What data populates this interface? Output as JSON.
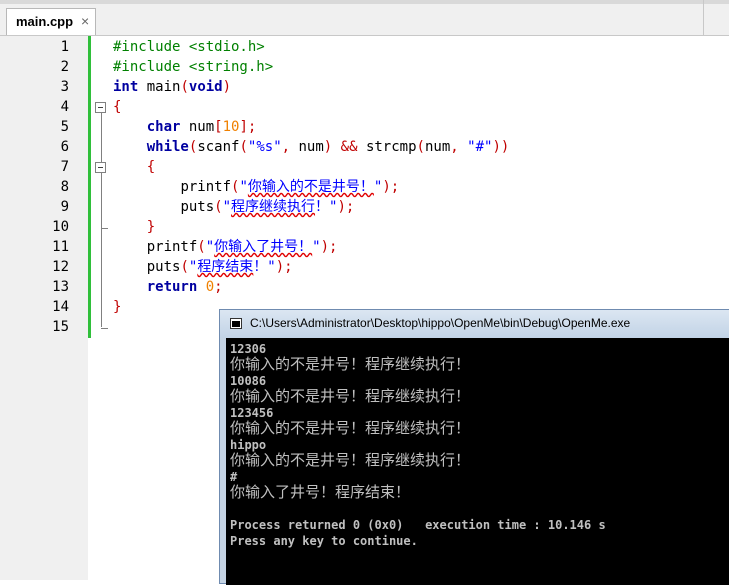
{
  "tab": {
    "label": "main.cpp",
    "close": "×"
  },
  "line_numbers": [
    "1",
    "2",
    "3",
    "4",
    "5",
    "6",
    "7",
    "8",
    "9",
    "10",
    "11",
    "12",
    "13",
    "14",
    "15"
  ],
  "code": {
    "l1": {
      "pp": "#include <stdio.h>"
    },
    "l2": {
      "pp": "#include <string.h>"
    },
    "l3": {
      "kw1": "int",
      "t1": " main",
      "op1": "(",
      "kw2": "void",
      "op2": ")"
    },
    "l4": {
      "op1": "{"
    },
    "l5": {
      "indent": "    ",
      "kw1": "char",
      "t1": " num",
      "op1": "[",
      "num1": "10",
      "op2": "];"
    },
    "l6": {
      "indent": "    ",
      "kw1": "while",
      "op1": "(",
      "t1": "scanf",
      "op2": "(",
      "str1": "\"%s\"",
      "op3": ",",
      "t2": " num",
      "op4": ")",
      "t3": " ",
      "op5": "&&",
      "t4": " strcmp",
      "op6": "(",
      "t5": "num",
      "op7": ",",
      "t6": " ",
      "str2": "\"#\"",
      "op8": "))"
    },
    "l7": {
      "indent": "    ",
      "op1": "{"
    },
    "l8": {
      "indent": "        ",
      "t1": "printf",
      "op1": "(",
      "str1": "\"",
      "sq1": "你输入的不是井号！",
      "str2": "\"",
      "op2": ");"
    },
    "l9": {
      "indent": "        ",
      "t1": "puts",
      "op1": "(",
      "str1": "\"",
      "sq1": "程序继续执行",
      "str2": "！\"",
      "op2": ");"
    },
    "l10": {
      "indent": "    ",
      "op1": "}"
    },
    "l11": {
      "indent": "    ",
      "t1": "printf",
      "op1": "(",
      "str1": "\"",
      "sq1": "你输入了井号！",
      "str2": "\"",
      "op2": ");"
    },
    "l12": {
      "indent": "    ",
      "t1": "puts",
      "op1": "(",
      "str1": "\"",
      "sq1": "程序结束",
      "str2": "！\"",
      "op2": ");"
    },
    "l13": {
      "indent": "    ",
      "kw1": "return",
      "t1": " ",
      "num1": "0",
      "op1": ";"
    },
    "l14": {
      "op1": "}"
    },
    "l15": {}
  },
  "console": {
    "title": "C:\\Users\\Administrator\\Desktop\\hippo\\OpenMe\\bin\\Debug\\OpenMe.exe",
    "lines": [
      "12306",
      "你输入的不是井号！程序继续执行！",
      "10086",
      "你输入的不是井号！程序继续执行！",
      "123456",
      "你输入的不是井号！程序继续执行！",
      "hippo",
      "你输入的不是井号！程序继续执行！",
      "#",
      "你输入了井号！程序结束！",
      "",
      "Process returned 0 (0x0)   execution time : 10.146 s",
      "Press any key to continue."
    ]
  },
  "colors": {
    "preprocessor": "#008000",
    "keyword": "#0000a0",
    "operator": "#c00000",
    "number": "#f08000",
    "string": "#0000ff",
    "change_bar": "#2fbf3a"
  }
}
